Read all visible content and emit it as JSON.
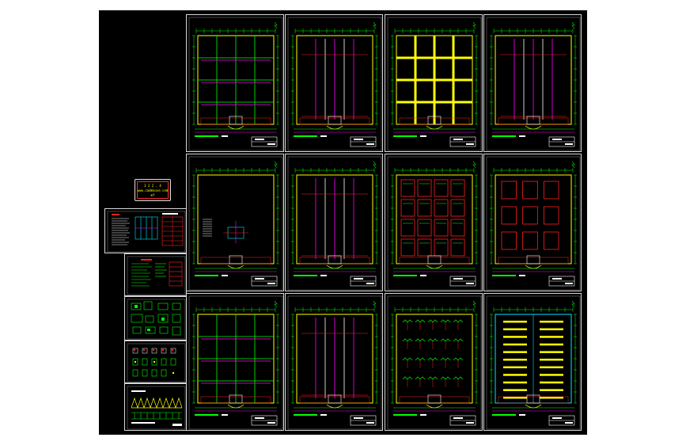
{
  "stamp": {
    "line1": "3 2 2 . 4",
    "line2": "www.cadmouse.com",
    "line3": "mf"
  },
  "colors": {
    "background": "#000000",
    "sheet_border": "#d8d8d8",
    "grid": "#00ff00",
    "wall": "#ffff00",
    "magenta": "#ff00ff",
    "red": "#ff2020",
    "cyan": "#00e5ff",
    "white": "#ffffff"
  }
}
